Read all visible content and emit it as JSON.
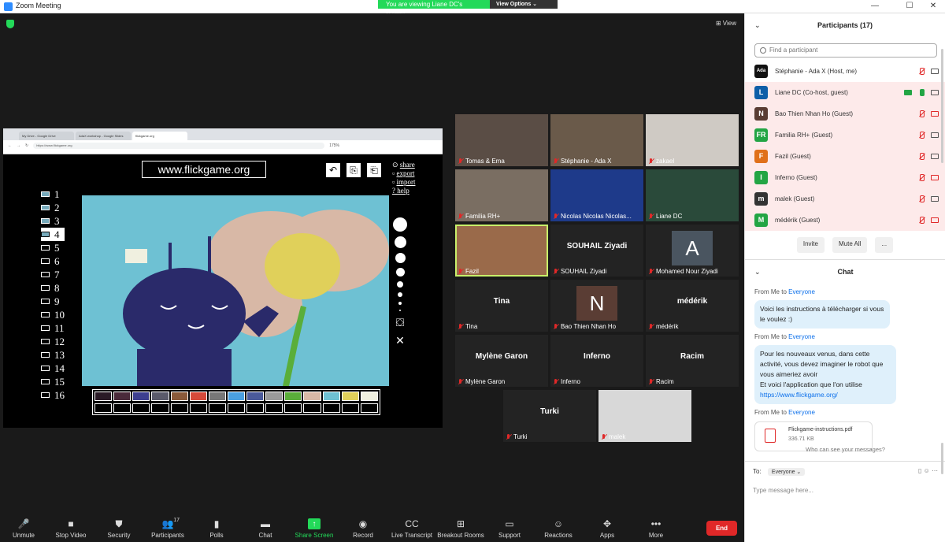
{
  "window": {
    "title": "Zoom Meeting",
    "controls": [
      "—",
      "☐",
      "✕"
    ]
  },
  "share_banner": {
    "viewing": "You are viewing Liane DC's screen",
    "view_options": "View Options ⌄"
  },
  "view_label": "View",
  "browser": {
    "tabs": [
      "My Drive - Google Drive",
      "AdaX workshop - Google Slides",
      "flickgame.org"
    ],
    "url": "https://www.flickgame.org",
    "zoom": "175%"
  },
  "flickgame": {
    "site": "www.flickgame.org",
    "menu": [
      "share",
      "export",
      "import",
      "? help"
    ],
    "frames": [
      "1",
      "2",
      "3",
      "4",
      "5",
      "6",
      "7",
      "8",
      "9",
      "10",
      "11",
      "12",
      "13",
      "14",
      "15",
      "16"
    ],
    "selected_frame": 4,
    "palette": [
      "#2a1a26",
      "#4a2a3a",
      "#3d3f8f",
      "#5a5a6a",
      "#8a5a3a",
      "#d64a3a",
      "#777777",
      "#4aa0e0",
      "#4a5a9a",
      "#9a9a9a",
      "#5aae3a",
      "#d8b8a6",
      "#6ec1d3",
      "#e0d05a",
      "#f0f0e0"
    ]
  },
  "participants_videos": [
    {
      "name": "Tomas & Ema",
      "kind": "video",
      "bg": "#5a4d45"
    },
    {
      "name": "Stéphanie - Ada X",
      "kind": "video",
      "bg": "#6a5a4a"
    },
    {
      "name": "zakael",
      "kind": "video",
      "bg": "#cfcac4"
    },
    {
      "name": "Familia RH+",
      "kind": "video",
      "bg": "#7a6e62"
    },
    {
      "name": "Nicolas Nicolas Nicolas...",
      "kind": "video",
      "bg": "#1e3a8a"
    },
    {
      "name": "Liane DC",
      "kind": "video",
      "bg": "#2a4a3a"
    },
    {
      "name": "Fazil",
      "kind": "video",
      "bg": "#9a6a4a",
      "speaking": true
    },
    {
      "name": "SOUHAIL  Ziyadi",
      "kind": "name"
    },
    {
      "name": "Mohamed Nour Ziyadi",
      "kind": "avatar",
      "initial": "A",
      "color": "#4a5560"
    },
    {
      "name": "Tina",
      "kind": "name"
    },
    {
      "name": "Bao Thien Nhan Ho",
      "kind": "avatar",
      "initial": "N",
      "color": "#5a3d34"
    },
    {
      "name": "médérik",
      "kind": "name"
    },
    {
      "name": "Mylène Garon",
      "kind": "name"
    },
    {
      "name": "Inferno",
      "kind": "name"
    },
    {
      "name": "Racim",
      "kind": "name"
    },
    {
      "name": "Turki",
      "kind": "name"
    },
    {
      "name": "malek",
      "kind": "video",
      "bg": "#d8d8d8"
    }
  ],
  "toolbar": [
    {
      "label": "Unmute",
      "icon": "mic-muted-icon",
      "glyph": "🎤"
    },
    {
      "label": "Stop Video",
      "icon": "video-icon",
      "glyph": "■"
    },
    {
      "label": "Security",
      "icon": "shield-icon",
      "glyph": "⛊"
    },
    {
      "label": "Participants",
      "icon": "participants-icon",
      "glyph": "👥",
      "count": "17"
    },
    {
      "label": "Polls",
      "icon": "polls-icon",
      "glyph": "▮"
    },
    {
      "label": "Chat",
      "icon": "chat-icon",
      "glyph": "▬"
    },
    {
      "label": "Share Screen",
      "icon": "share-screen-icon",
      "glyph": "↑"
    },
    {
      "label": "Record",
      "icon": "record-icon",
      "glyph": "◉"
    },
    {
      "label": "Live Transcript",
      "icon": "cc-icon",
      "glyph": "CC"
    },
    {
      "label": "Breakout Rooms",
      "icon": "breakout-icon",
      "glyph": "⊞"
    },
    {
      "label": "Support",
      "icon": "support-icon",
      "glyph": "▭"
    },
    {
      "label": "Reactions",
      "icon": "reactions-icon",
      "glyph": "☺"
    },
    {
      "label": "Apps",
      "icon": "apps-icon",
      "glyph": "✥"
    },
    {
      "label": "More",
      "icon": "more-icon",
      "glyph": "•••"
    }
  ],
  "end_label": "End",
  "participants_panel": {
    "title": "Participants (17)",
    "search_placeholder": "Find a participant",
    "list": [
      {
        "name": "Stéphanie - Ada X (Host, me)",
        "initial": "Ada",
        "color": "#111111",
        "mic": "muted",
        "cam": "on"
      },
      {
        "name": "Liane DC (Co-host, guest)",
        "initial": "L",
        "color": "#0e5fa8",
        "mic": "on",
        "cam": "on",
        "sharing": true
      },
      {
        "name": "Bao Thien Nhan Ho (Guest)",
        "initial": "N",
        "color": "#5a3d34",
        "mic": "muted",
        "cam": "off"
      },
      {
        "name": "Familia RH+ (Guest)",
        "initial": "FR",
        "color": "#23a544",
        "mic": "muted",
        "cam": "on"
      },
      {
        "name": "Fazil (Guest)",
        "initial": "F",
        "color": "#e0701a",
        "mic": "muted",
        "cam": "on"
      },
      {
        "name": "Inferno (Guest)",
        "initial": "I",
        "color": "#23a544",
        "mic": "muted",
        "cam": "off"
      },
      {
        "name": "malek (Guest)",
        "initial": "m",
        "color": "#333333",
        "mic": "muted",
        "cam": "on"
      },
      {
        "name": "médérik (Guest)",
        "initial": "M",
        "color": "#23a544",
        "mic": "muted",
        "cam": "off"
      }
    ],
    "invite": "Invite",
    "mute_all": "Mute All",
    "more": "..."
  },
  "chat": {
    "title": "Chat",
    "from_prefix": "From Me to ",
    "to_everyone": "Everyone",
    "messages": [
      {
        "text": "Voici les instructions à télécharger si vous le voulez :)"
      },
      {
        "text": "Pour les nouveaux venus, dans cette activité, vous devez imaginer le robot que vous aimeriez avoir\nEt voici l'application que l'on utilise",
        "link": "https://www.flickgame.org/"
      }
    ],
    "file": {
      "name": "Flickgame-instructions.pdf",
      "size": "336.71 KB"
    },
    "who_can_see": "Who can see your messages?",
    "to_label": "To:",
    "to_value": "Everyone",
    "input_placeholder": "Type message here..."
  }
}
